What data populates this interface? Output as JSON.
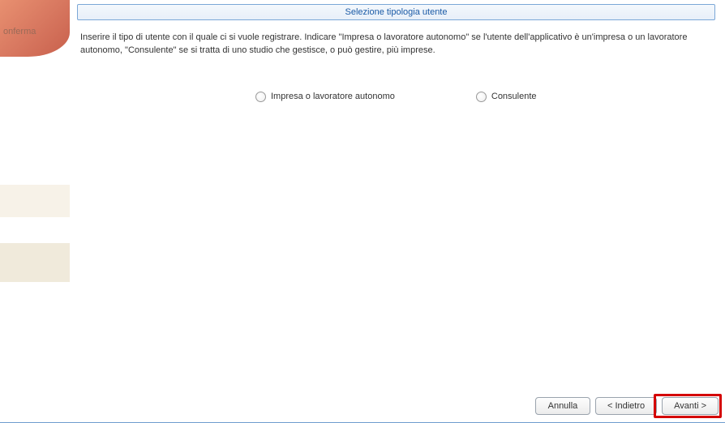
{
  "sidebar": {
    "label": "onferma"
  },
  "panel": {
    "title": "Selezione tipologia utente",
    "description": "Inserire il tipo di utente con il quale ci si vuole registrare. Indicare \"Impresa o lavoratore autonomo\" se l'utente dell'applicativo è un'impresa o un lavoratore autonomo, \"Consulente\" se si tratta di uno studio che gestisce, o può gestire, più imprese."
  },
  "options": {
    "impresa": "Impresa o lavoratore autonomo",
    "consulente": "Consulente"
  },
  "buttons": {
    "cancel": "Annulla",
    "back": "< Indietro",
    "next": "Avanti >"
  }
}
